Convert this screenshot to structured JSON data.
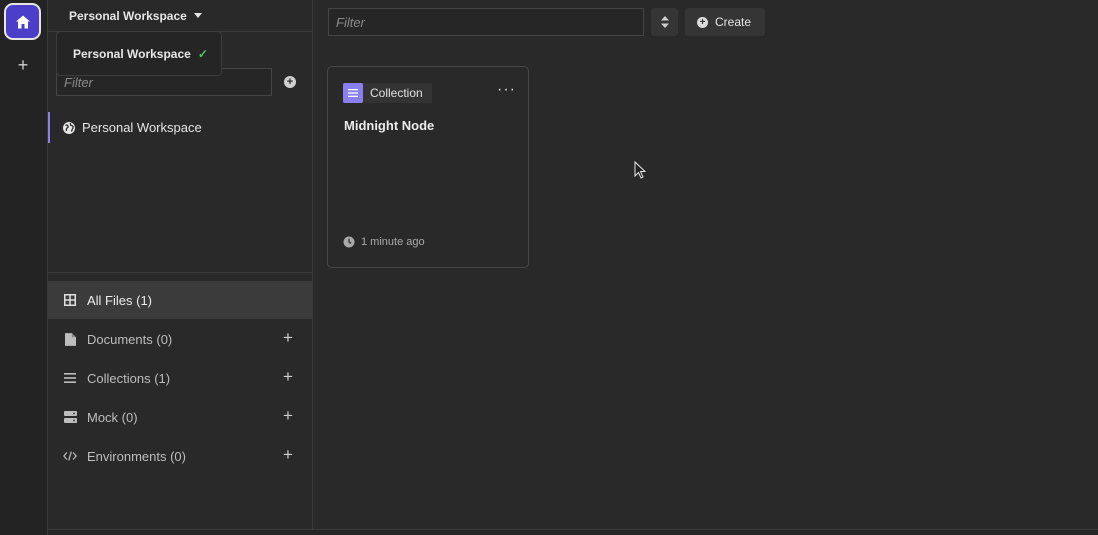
{
  "workspace": {
    "title": "Personal Workspace",
    "dropdown_item": "Personal Workspace"
  },
  "sidebar": {
    "filter_placeholder": "Filter",
    "project": "Personal Workspace",
    "nav": [
      {
        "label": "All Files (1)",
        "icon": "grid-icon",
        "active": true
      },
      {
        "label": "Documents (0)",
        "icon": "document-icon"
      },
      {
        "label": "Collections (1)",
        "icon": "list-icon"
      },
      {
        "label": "Mock (0)",
        "icon": "server-icon"
      },
      {
        "label": "Environments (0)",
        "icon": "code-icon"
      }
    ]
  },
  "toolbar": {
    "filter_placeholder": "Filter",
    "create_label": "Create"
  },
  "card": {
    "badge": "Collection",
    "title": "Midnight Node",
    "timestamp": "1 minute ago"
  },
  "colors": {
    "accent": "#8b7ff0",
    "home": "#4b3fc9",
    "check": "#4fc26d"
  }
}
